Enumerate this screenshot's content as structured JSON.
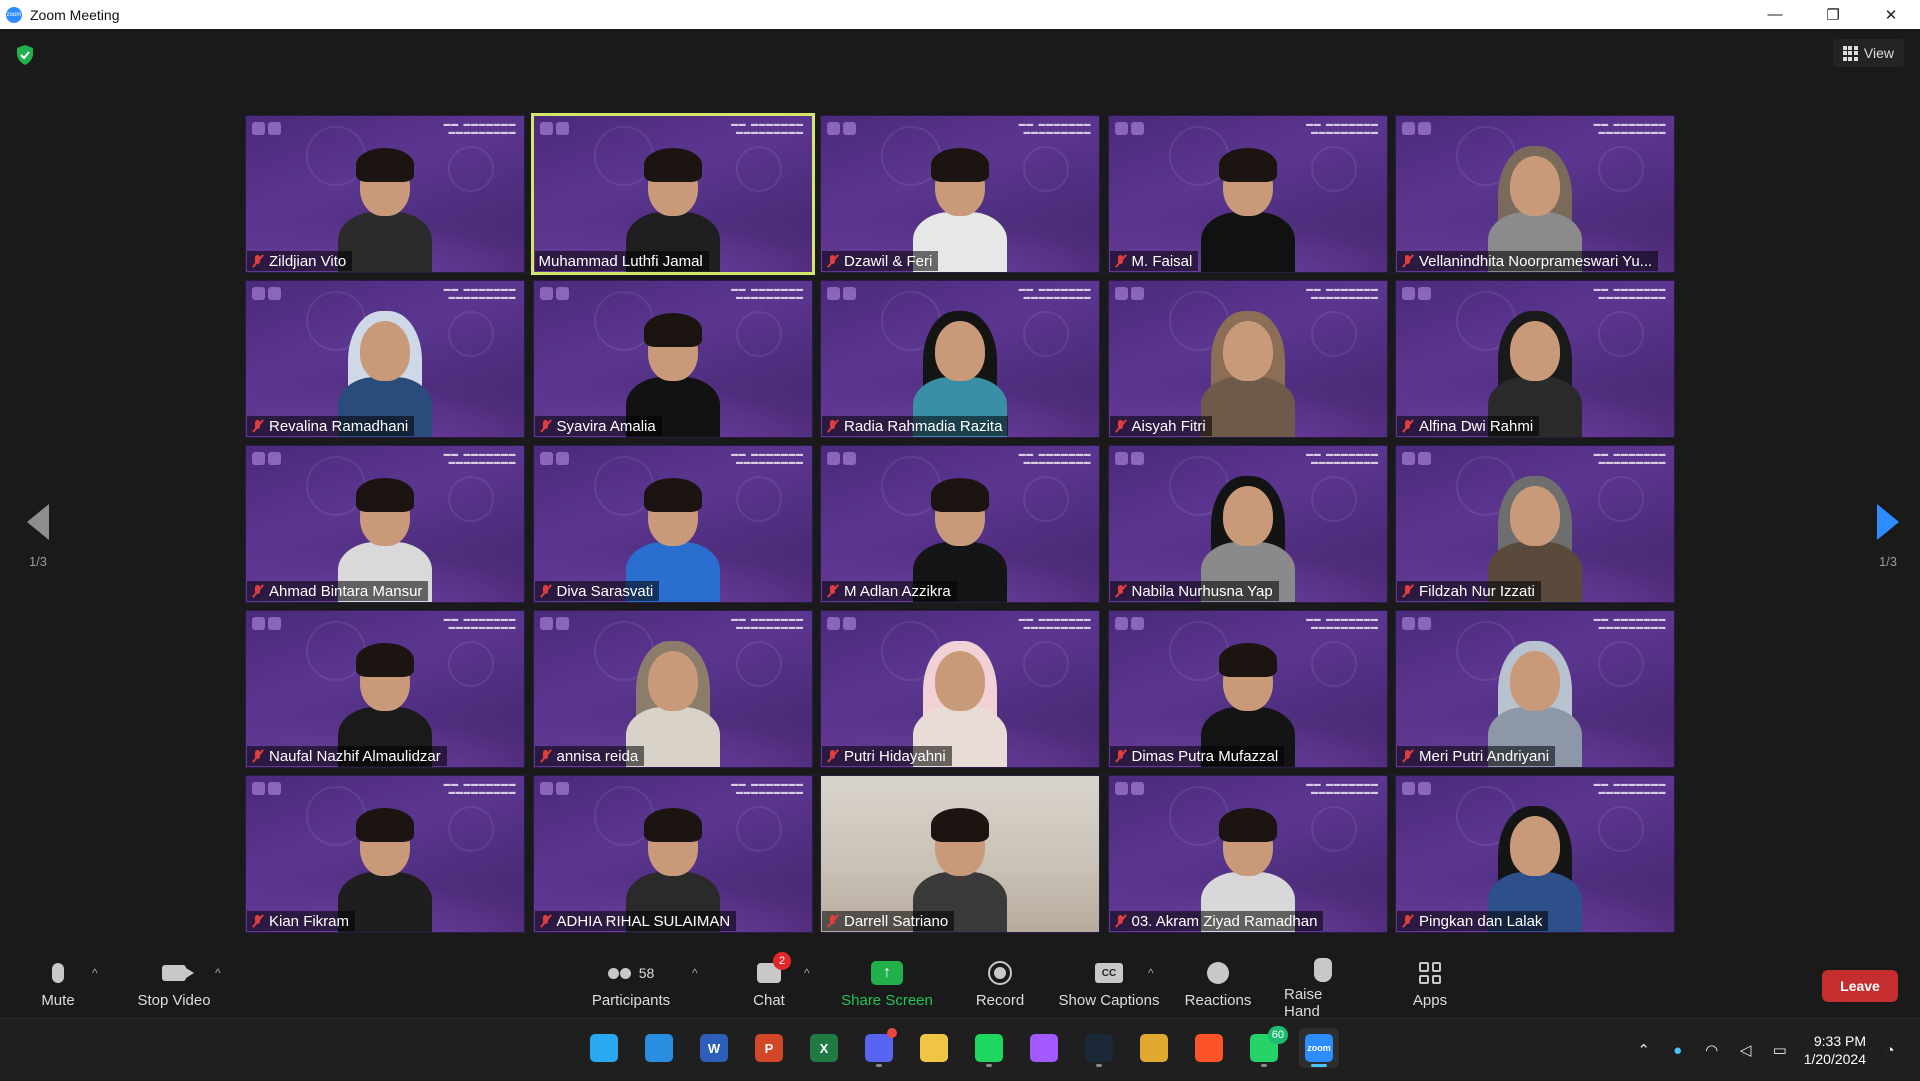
{
  "window": {
    "title": "Zoom Meeting"
  },
  "view_button": {
    "label": "View"
  },
  "pagination": {
    "left": "1/3",
    "right": "1/3"
  },
  "participants": [
    {
      "name": "Zildjian Vito",
      "muted": true,
      "active": false,
      "style": "boy",
      "shirt": "#2b2b2b"
    },
    {
      "name": "Muhammad Luthfi Jamal",
      "muted": false,
      "active": true,
      "style": "boy",
      "shirt": "#1f1f1f"
    },
    {
      "name": "Dzawil & Feri",
      "muted": true,
      "active": false,
      "style": "boy",
      "shirt": "#e7e7e7"
    },
    {
      "name": "M. Faisal",
      "muted": true,
      "active": false,
      "style": "boy",
      "shirt": "#111111"
    },
    {
      "name": "Vellanindhita Noorprameswari Yu...",
      "muted": true,
      "active": false,
      "style": "hijab",
      "hijab": "#7a6a5c",
      "shirt": "#8b8b8b"
    },
    {
      "name": "Revalina Ramadhani",
      "muted": true,
      "active": false,
      "style": "hijab",
      "hijab": "#cfd8e6",
      "shirt": "#2a4c7a"
    },
    {
      "name": "Syavira Amalia",
      "muted": true,
      "active": false,
      "style": "girl",
      "shirt": "#121212"
    },
    {
      "name": "Radia Rahmadia Razita",
      "muted": true,
      "active": false,
      "style": "hijab",
      "hijab": "#141414",
      "shirt": "#3a8fa6"
    },
    {
      "name": "Aisyah Fitri",
      "muted": true,
      "active": false,
      "style": "hijab",
      "hijab": "#8b6e55",
      "shirt": "#6d5a4a"
    },
    {
      "name": "Alfina Dwi Rahmi",
      "muted": true,
      "active": false,
      "style": "hijab",
      "hijab": "#1a1a1a",
      "shirt": "#2a2a2a"
    },
    {
      "name": "Ahmad Bintara Mansur",
      "muted": true,
      "active": false,
      "style": "boy",
      "shirt": "#d9d9d9"
    },
    {
      "name": "Diva Sarasvati",
      "muted": true,
      "active": false,
      "style": "girl",
      "shirt": "#2a6fd0"
    },
    {
      "name": "M Adlan Azzikra",
      "muted": true,
      "active": false,
      "style": "boy",
      "shirt": "#151515"
    },
    {
      "name": "Nabila Nurhusna Yap",
      "muted": true,
      "active": false,
      "style": "hijab",
      "hijab": "#131313",
      "shirt": "#8a8a8a"
    },
    {
      "name": "Fildzah Nur Izzati",
      "muted": true,
      "active": false,
      "style": "hijab",
      "hijab": "#6e6e6e",
      "shirt": "#5a4a3c"
    },
    {
      "name": "Naufal Nazhif Almaulidzar",
      "muted": true,
      "active": false,
      "style": "boy",
      "shirt": "#1a1a1a"
    },
    {
      "name": "annisa reida",
      "muted": true,
      "active": false,
      "style": "hijab",
      "hijab": "#8c7d6b",
      "shirt": "#d8d2c8"
    },
    {
      "name": "Putri Hidayahni",
      "muted": true,
      "active": false,
      "style": "hijab",
      "hijab": "#f0d2d6",
      "shirt": "#e8dcd6"
    },
    {
      "name": "Dimas Putra Mufazzal",
      "muted": true,
      "active": false,
      "style": "boy",
      "shirt": "#141414"
    },
    {
      "name": "Meri Putri Andriyani",
      "muted": true,
      "active": false,
      "style": "hijab",
      "hijab": "#b9c2cf",
      "shirt": "#8e97a8"
    },
    {
      "name": "Kian Fikram",
      "muted": true,
      "active": false,
      "style": "boy",
      "shirt": "#1e1e1e"
    },
    {
      "name": "ADHIA RIHAL SULAIMAN",
      "muted": true,
      "active": false,
      "style": "boy",
      "shirt": "#2a2a2a"
    },
    {
      "name": "Darrell Satriano",
      "muted": true,
      "active": false,
      "style": "boy-plain",
      "shirt": "#3a3a3a"
    },
    {
      "name": "03. Akram Ziyad Ramadhan",
      "muted": true,
      "active": false,
      "style": "boy",
      "shirt": "#d8d8d8"
    },
    {
      "name": "Pingkan dan Lalak",
      "muted": true,
      "active": false,
      "style": "hijab",
      "hijab": "#151515",
      "shirt": "#2d4f8a"
    }
  ],
  "toolbar": {
    "mute": "Mute",
    "stop_video": "Stop Video",
    "participants": "Participants",
    "participants_count": "58",
    "chat": "Chat",
    "chat_badge": "2",
    "share_screen": "Share Screen",
    "record": "Record",
    "show_captions": "Show Captions",
    "captions_icon": "CC",
    "reactions": "Reactions",
    "raise_hand": "Raise Hand",
    "apps": "Apps",
    "leave": "Leave"
  },
  "taskbar": {
    "apps": [
      {
        "name": "windows-start-icon",
        "color": "#2aa8f2",
        "label": ""
      },
      {
        "name": "vscode-icon",
        "color": "#2a8ee0",
        "label": ""
      },
      {
        "name": "word-icon",
        "color": "#2b5fb8",
        "label": "W"
      },
      {
        "name": "powerpoint-icon",
        "color": "#d24726",
        "label": "P"
      },
      {
        "name": "excel-icon",
        "color": "#1f7a44",
        "label": "X"
      },
      {
        "name": "discord-icon",
        "color": "#5865f2",
        "label": ""
      },
      {
        "name": "file-explorer-icon",
        "color": "#f2c443",
        "label": ""
      },
      {
        "name": "spotify-icon",
        "color": "#1ed760",
        "label": ""
      },
      {
        "name": "figma-icon",
        "color": "#a259ff",
        "label": ""
      },
      {
        "name": "steam-icon",
        "color": "#1b2838",
        "label": ""
      },
      {
        "name": "chrome-icon",
        "color": "#e0a82e",
        "label": ""
      },
      {
        "name": "brave-icon",
        "color": "#fb542b",
        "label": ""
      },
      {
        "name": "whatsapp-icon",
        "color": "#25d366",
        "label": ""
      },
      {
        "name": "zoom-icon",
        "color": "#2d8cff",
        "label": "zoom"
      }
    ],
    "whatsapp_badge": "60",
    "time": "9:33 PM",
    "date": "1/20/2024"
  }
}
